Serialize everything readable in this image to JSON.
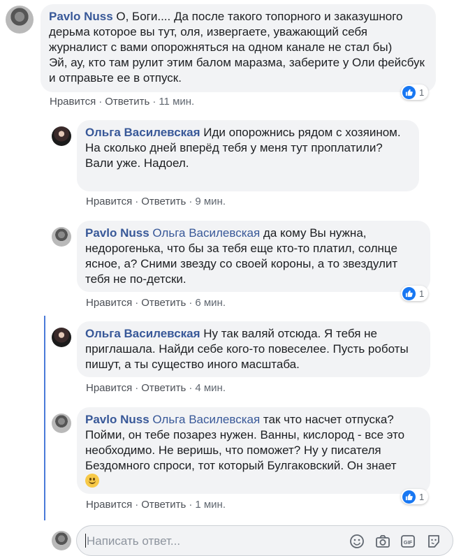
{
  "comments": [
    {
      "author": "Pavlo Nuss",
      "mention": "",
      "text": " О, Боги.... Да после такого топорного и заказушного дерьма которое вы тут, оля, извергаете, уважающий себя журналист с вами опорожняться на одном канале не стал бы)\nЭй, ау, кто там рулит этим балом маразма, заберите у Оли фейсбук и отправьте ее в отпуск.",
      "like_label": "Нравится",
      "reply_label": "Ответить",
      "time": "11 мин.",
      "reactions": "1"
    },
    {
      "author": "Ольга Василевская",
      "mention": "",
      "text": " Иди опорожнись рядом с хозяином.\nНа сколько дней вперёд тебя у меня тут проплатили?\nВали уже. Надоел.",
      "like_label": "Нравится",
      "reply_label": "Ответить",
      "time": "9 мин."
    },
    {
      "author": "Pavlo Nuss",
      "mention": "Ольга Василевская",
      "text": " да кому Вы нужна, недорогенька, что бы за тебя еще кто-то платил, солнце ясное, а? Сними звезду со своей короны, а то звездулит тебя не по-детски.",
      "like_label": "Нравится",
      "reply_label": "Ответить",
      "time": "6 мин.",
      "reactions": "1"
    },
    {
      "author": "Ольга Василевская",
      "mention": "",
      "text": " Ну так валяй отсюда. Я тебя не приглашала. Найди себе кого-то повеселее. Пусть роботы пишут, а ты существо иного масштаба.",
      "like_label": "Нравится",
      "reply_label": "Ответить",
      "time": "4 мин."
    },
    {
      "author": "Pavlo Nuss",
      "mention": "Ольга Василевская",
      "text": " так что насчет отпуска? Пойми, он тебе позарез нужен. Ванны, кислород - все это необходимо. Не веришь, что поможет? Ну у писателя Бездомного спроси, тот который Булгаковский. Он знает",
      "like_label": "Нравится",
      "reply_label": "Ответить",
      "time": "1 мин.",
      "reactions": "1"
    }
  ],
  "separator": "·",
  "reply_box": {
    "placeholder": "Написать ответ..."
  },
  "icons": [
    "like-icon",
    "smiley-icon",
    "camera-icon",
    "gif-icon",
    "sticker-icon"
  ],
  "colors": {
    "author": "#385898",
    "like": "#1877f2",
    "thread_line": "#4a7ad8",
    "bubble": "#f2f3f5"
  }
}
